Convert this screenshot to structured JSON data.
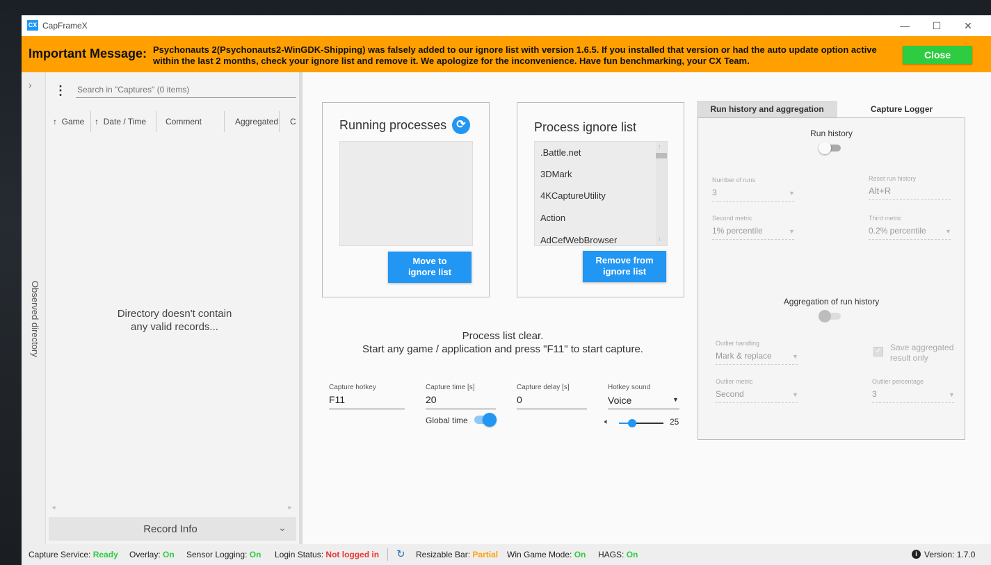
{
  "window": {
    "title": "CapFrameX",
    "app_icon": "CX",
    "minimize": "—",
    "maximize": "☐",
    "close": "✕"
  },
  "banner": {
    "title": "Important Message:",
    "message": "Psychonauts 2(Psychonauts2-WinGDK-Shipping) was falsely added to our ignore list with version 1.6.5. If you installed that version or had the auto update option active within the last 2 months, check your ignore list and remove it. We apologize for the inconvenience. Have fun benchmarking, your CX Team.",
    "close_label": "Close",
    "color": "#ffa000"
  },
  "sidebar": {
    "observed_directory": "Observed directory",
    "search_placeholder": "Search in \"Captures\" (0 items)",
    "columns": [
      "Game",
      "Date / Time",
      "Comment",
      "Aggregated",
      "C"
    ],
    "empty_message_line1": "Directory doesn't contain",
    "empty_message_line2": "any valid records...",
    "record_info": "Record Info"
  },
  "running_processes": {
    "title": "Running processes",
    "move_button_line1": "Move to",
    "move_button_line2": "ignore list"
  },
  "ignore_list": {
    "title": "Process ignore list",
    "items": [
      ".Battle.net",
      "3DMark",
      "4KCaptureUtility",
      "Action",
      "AdCefWebBrowser"
    ],
    "remove_button_line1": "Remove from",
    "remove_button_line2": "ignore list"
  },
  "status_message": {
    "line1": "Process list clear.",
    "line2": "Start any game / application and press \"F11\" to start capture."
  },
  "capture_settings": {
    "hotkey_label": "Capture hotkey",
    "hotkey_value": "F11",
    "time_label": "Capture time [s]",
    "time_value": "20",
    "delay_label": "Capture delay [s]",
    "delay_value": "0",
    "sound_label": "Hotkey sound",
    "sound_value": "Voice",
    "global_time_label": "Global time",
    "global_time_on": true,
    "volume": "25"
  },
  "right_panel": {
    "tabs": [
      "Run history and aggregation",
      "Capture Logger"
    ],
    "run_history_label": "Run history",
    "number_of_runs_label": "Number of runs",
    "number_of_runs_value": "3",
    "reset_label": "Reset run history",
    "reset_value": "Alt+R",
    "second_metric_label": "Second metric",
    "second_metric_value": "1% percentile",
    "third_metric_label": "Third metric",
    "third_metric_value": "0.2% percentile",
    "aggregation_label": "Aggregation of run history",
    "outlier_handling_label": "Outlier handling",
    "outlier_handling_value": "Mark & replace",
    "save_aggregated_line1": "Save aggregated",
    "save_aggregated_line2": "result only",
    "outlier_metric_label": "Outlier metric",
    "outlier_metric_value": "Second",
    "outlier_percentage_label": "Outlier percentage",
    "outlier_percentage_value": "3"
  },
  "statusbar": {
    "capture_service_label": "Capture Service:",
    "capture_service_value": "Ready",
    "overlay_label": "Overlay:",
    "overlay_value": "On",
    "sensor_label": "Sensor Logging:",
    "sensor_value": "On",
    "login_label": "Login Status:",
    "login_value": "Not logged in",
    "rebar_label": "Resizable Bar:",
    "rebar_value": "Partial",
    "gamemode_label": "Win Game Mode:",
    "gamemode_value": "On",
    "hags_label": "HAGS:",
    "hags_value": "On",
    "version": "Version:  1.7.0"
  },
  "colors": {
    "accent": "#2196f3",
    "ok": "#2ecc40",
    "error": "#e53935",
    "warning": "#ffa000"
  }
}
